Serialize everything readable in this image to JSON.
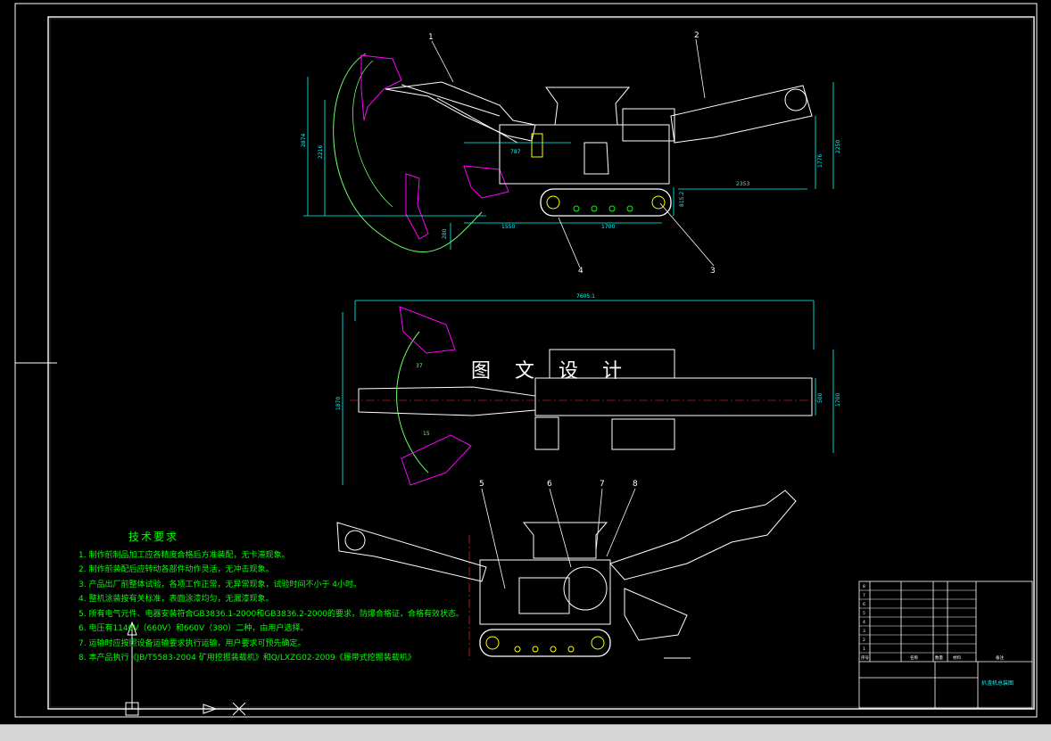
{
  "watermark": "图 文 设 计",
  "colors": {
    "background": "#000000",
    "frame": "#ffffff",
    "machine": "#ffffff",
    "dimension": "#00ffff",
    "swing_arc": "#66ff66",
    "bucket": "#ff00ff",
    "notes_text": "#00ff00",
    "centerline": "#ff3333",
    "highlight": "#ffff00"
  },
  "callouts": [
    "1",
    "2",
    "3",
    "4",
    "5",
    "6",
    "7",
    "8"
  ],
  "dimensions": {
    "side_view": [
      "2874",
      "2216",
      "787",
      "1776",
      "2250",
      "2353",
      "815.2",
      "1550",
      "1700",
      "280"
    ],
    "plan_view": [
      "7605.1",
      "1870",
      "500",
      "1700",
      "37",
      "15"
    ]
  },
  "tech_notes": {
    "title": "技术要求",
    "items": [
      "1. 制作前制品加工应各精度合格后方准装配，无卡滞现象。",
      "2. 制作前装配后应转动各部件动作灵活，无冲击现象。",
      "3. 产品出厂前整体试验，各项工作正常，无异常现象，试验时间不小于 4小时。",
      "4. 整机涂装按有关标准，表面涂漆均匀，无漏漆现象。",
      "5. 所有电气元件、电器安装符合GB3836.1-2000和GB3836.2-2000的要求，防爆合格证，合格有效状态。",
      "6. 电压有1140V（660V）和660V（380）二种，由用户选择。",
      "7. 运输时应按照设备运输要求执行运输，用户要求可预先确定。",
      "8. 本产品执行《JB/T5583-2004 矿用挖掘装载机》和Q/LXZG02-2009《履带式挖掘装载机》"
    ]
  },
  "title_block": {
    "name": "扒渣机总装图",
    "cells": [
      "8",
      "7",
      "6",
      "5",
      "4",
      "3",
      "2",
      "1",
      "序号",
      "名称",
      "数量",
      "材料",
      "备注"
    ]
  }
}
